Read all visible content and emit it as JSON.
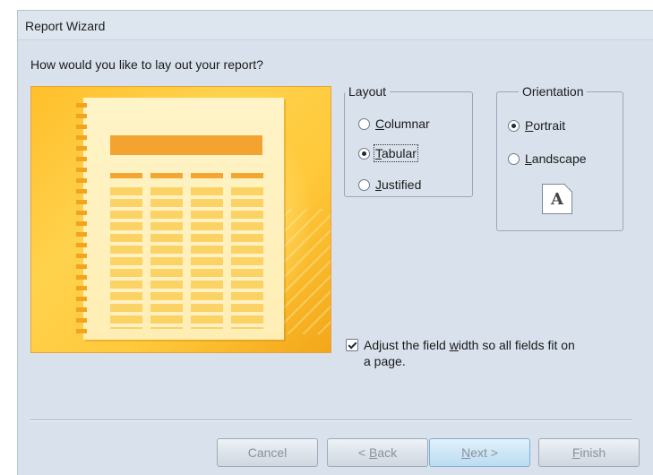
{
  "window": {
    "title": "Report Wizard"
  },
  "prompt": "How would you like to lay out your report?",
  "layout": {
    "legend": "Layout",
    "options": [
      {
        "label": "Columnar",
        "mnemonic": "C",
        "rest": "olumnar",
        "selected": false
      },
      {
        "label": "Tabular",
        "mnemonic": "T",
        "rest": "abular",
        "selected": true
      },
      {
        "label": "Justified",
        "mnemonic": "J",
        "rest": "ustified",
        "selected": false
      }
    ]
  },
  "orientation": {
    "legend": "Orientation",
    "options": [
      {
        "label": "Portrait",
        "mnemonic": "P",
        "rest": "ortrait",
        "selected": true
      },
      {
        "label": "Landscape",
        "mnemonic": "L",
        "rest": "andscape",
        "selected": false
      }
    ],
    "icon_letter": "A"
  },
  "adjust_width": {
    "checked": true,
    "line1_pre": "Adjust the field ",
    "line1_mnemonic": "w",
    "line1_post": "idth so all fields fit on",
    "line2": "a page."
  },
  "buttons": {
    "cancel": "Cancel",
    "back_pre": "< ",
    "back_mnemonic": "B",
    "back_post": "ack",
    "next_mnemonic": "N",
    "next_post": "ext >",
    "finish_mnemonic": "F",
    "finish_post": "inish"
  },
  "colors": {
    "preview_accent": "#f3a430",
    "window_bg": "#d9e2ec"
  }
}
